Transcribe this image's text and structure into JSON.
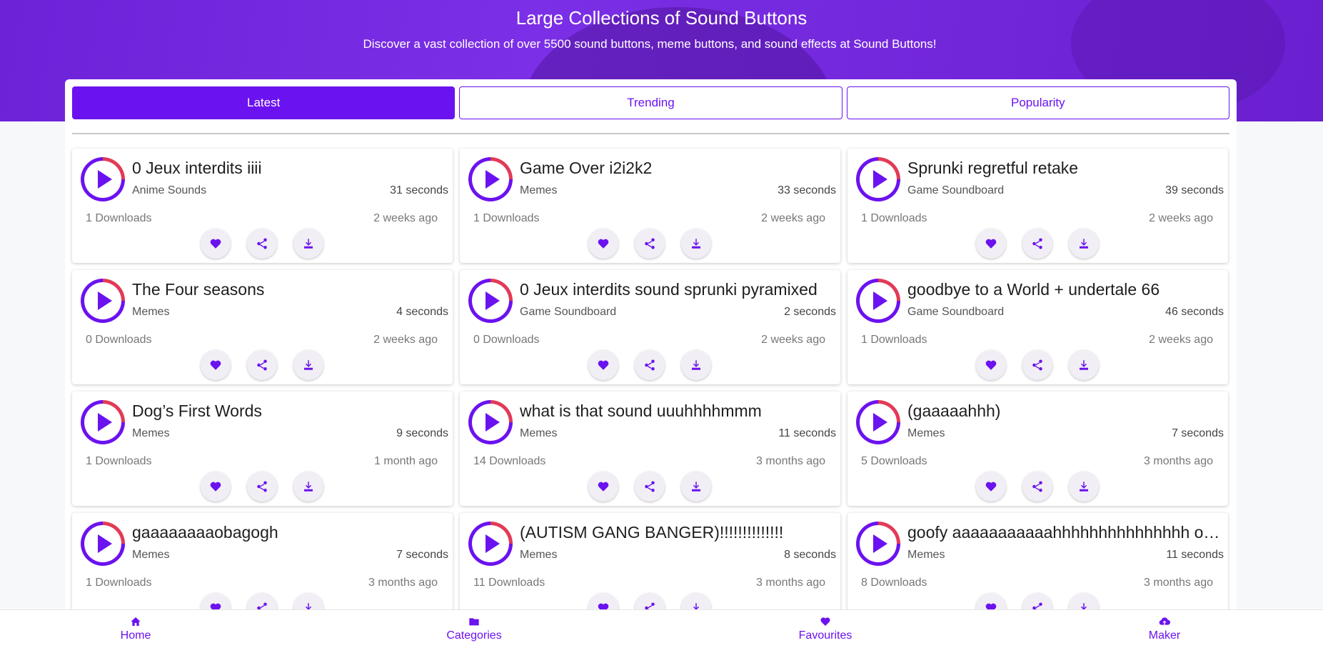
{
  "header": {
    "title": "Large Collections of Sound Buttons",
    "subtitle": "Discover a vast collection of over 5500 sound buttons, meme buttons, and sound effects at Sound Buttons!"
  },
  "tabs": [
    {
      "label": "Latest",
      "active": true
    },
    {
      "label": "Trending",
      "active": false
    },
    {
      "label": "Popularity",
      "active": false
    }
  ],
  "sounds": [
    {
      "title": "0 Jeux interdits iiii",
      "category": "Anime Sounds",
      "duration": "31 seconds",
      "downloads": "1 Downloads",
      "age": "2 weeks ago"
    },
    {
      "title": "Game Over i2i2k2",
      "category": "Memes",
      "duration": "33 seconds",
      "downloads": "1 Downloads",
      "age": "2 weeks ago"
    },
    {
      "title": "Sprunki regretful retake",
      "category": "Game Soundboard",
      "duration": "39 seconds",
      "downloads": "1 Downloads",
      "age": "2 weeks ago"
    },
    {
      "title": "The Four seasons",
      "category": "Memes",
      "duration": "4 seconds",
      "downloads": "0 Downloads",
      "age": "2 weeks ago"
    },
    {
      "title": "0 Jeux interdits sound sprunki pyramixed",
      "category": "Game Soundboard",
      "duration": "2 seconds",
      "downloads": "0 Downloads",
      "age": "2 weeks ago"
    },
    {
      "title": "goodbye to a World + undertale 66",
      "category": "Game Soundboard",
      "duration": "46 seconds",
      "downloads": "1 Downloads",
      "age": "2 weeks ago"
    },
    {
      "title": "Dog’s First Words",
      "category": "Memes",
      "duration": "9 seconds",
      "downloads": "1 Downloads",
      "age": "1 month ago"
    },
    {
      "title": "what is that sound uuuhhhhmmm",
      "category": "Memes",
      "duration": "11 seconds",
      "downloads": "14 Downloads",
      "age": "3 months ago"
    },
    {
      "title": "(gaaaaahhh)",
      "category": "Memes",
      "duration": "7 seconds",
      "downloads": "5 Downloads",
      "age": "3 months ago"
    },
    {
      "title": "gaaaaaaaaobagogh",
      "category": "Memes",
      "duration": "7 seconds",
      "downloads": "1 Downloads",
      "age": "3 months ago"
    },
    {
      "title": "(AUTISM GANG BANGER)!!!!!!!!!!!!!!",
      "category": "Memes",
      "duration": "8 seconds",
      "downloads": "11 Downloads",
      "age": "3 months ago"
    },
    {
      "title": "goofy aaaaaaaaaaahhhhhhhhhhhhhhh oooohhhhh",
      "category": "Memes",
      "duration": "11 seconds",
      "downloads": "8 Downloads",
      "age": "3 months ago"
    }
  ],
  "bottom_nav": [
    {
      "label": "Home",
      "icon": "home-icon"
    },
    {
      "label": "Categories",
      "icon": "folder-icon"
    },
    {
      "label": "Favourites",
      "icon": "heart-icon"
    },
    {
      "label": "Maker",
      "icon": "cloud-upload-icon"
    }
  ],
  "colors": {
    "accent": "#6b12f0",
    "ring_accent": "#e23a57",
    "hero": "#7b2fe6"
  }
}
